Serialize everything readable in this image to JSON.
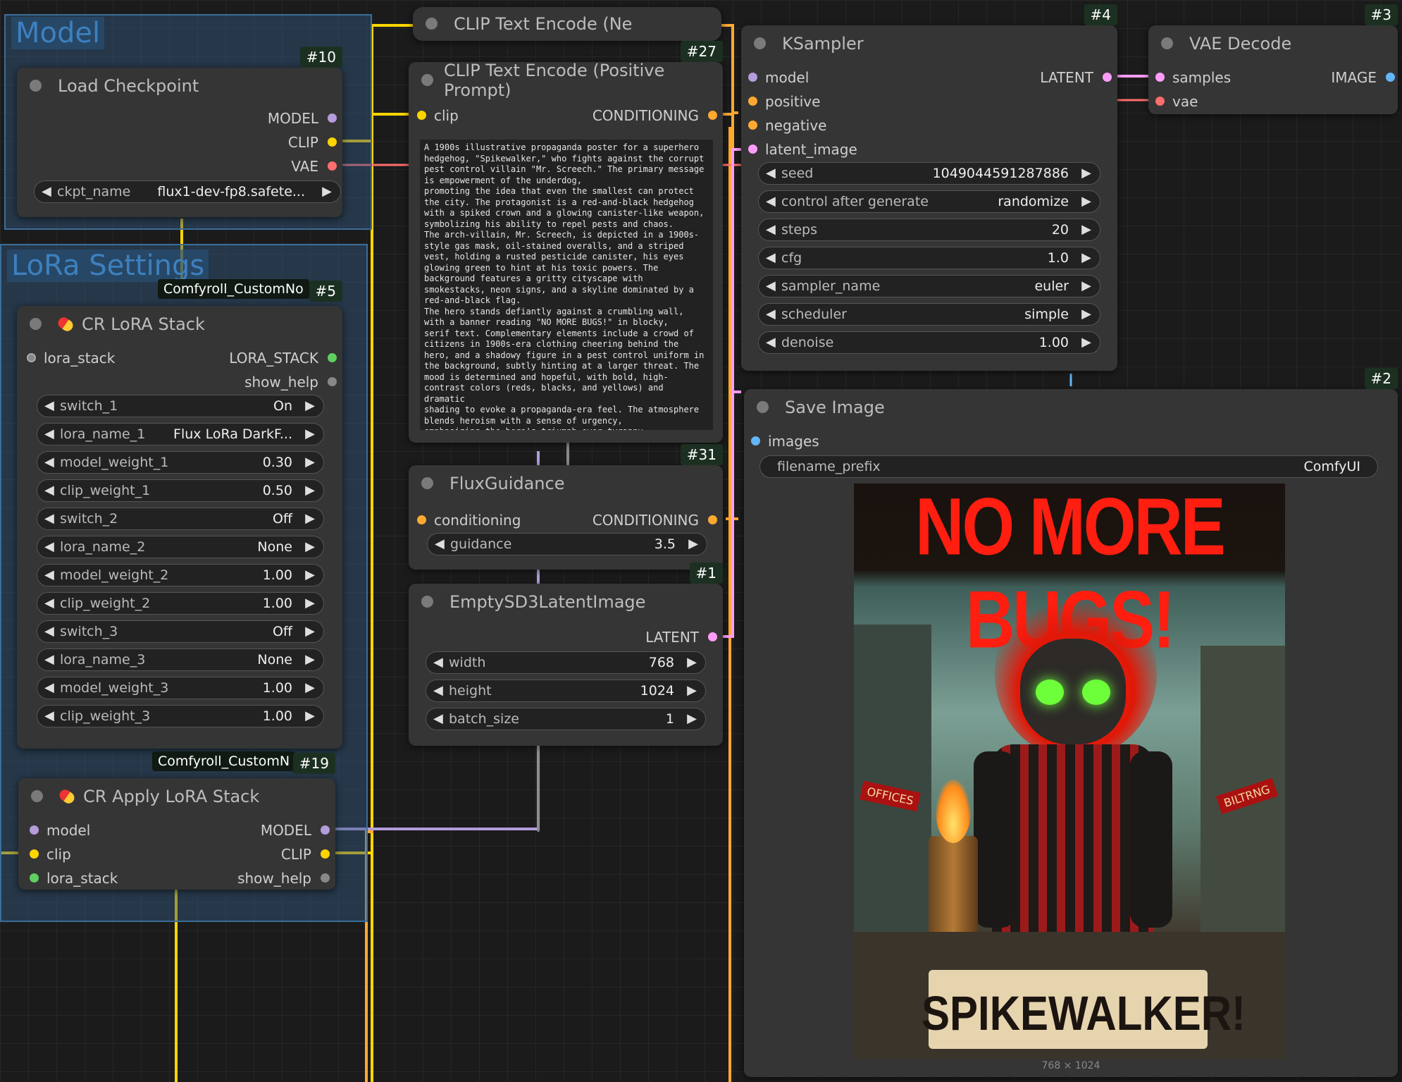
{
  "groups": {
    "model": "Model",
    "lora": "LoRa Settings"
  },
  "nodes": {
    "load_checkpoint": {
      "badge": "#10",
      "title": "Load Checkpoint",
      "out_model": "MODEL",
      "out_clip": "CLIP",
      "out_vae": "VAE",
      "ckpt_label": "ckpt_name",
      "ckpt_value": "flux1-dev-fp8.safete..."
    },
    "clip_neg": {
      "title": "CLIP Text Encode (Ne"
    },
    "clip_pos": {
      "badge": "#27",
      "title": "CLIP Text Encode (Positive Prompt)",
      "in_clip": "clip",
      "out": "CONDITIONING",
      "prompt": "A 1900s illustrative propaganda poster for a superhero hedgehog, \"Spikewalker,\" who fights against the corrupt pest control villain \"Mr. Screech.\" The primary message is empowerment of the underdog,\npromoting the idea that even the smallest can protect the city. The protagonist is a red-and-black hedgehog\nwith a spiked crown and a glowing canister-like weapon, symbolizing his ability to repel pests and chaos.\nThe arch-villain, Mr. Screech, is depicted in a 1900s-style gas mask, oil-stained overalls, and a striped vest, holding a rusted pesticide canister, his eyes glowing green to hint at his toxic powers. The background features a gritty cityscape with smokestacks, neon signs, and a skyline dominated by a red-and-black flag.\nThe hero stands defiantly against a crumbling wall, with a banner reading \"NO MORE BUGS!\" in blocky,\nserif text. Complementary elements include a crowd of citizens in 1900s-era clothing cheering behind the hero, and a shadowy figure in a pest control uniform in the background, subtly hinting at a larger threat. The mood is determined and hopeful, with bold, high-contrast colors (reds, blacks, and yellows) and dramatic\nshading to evoke a propaganda-era feel. The atmosphere blends heroism with a sense of urgency,\nemphasizing the hero's triumph over tyranny."
    },
    "ksampler": {
      "badge": "#4",
      "title": "KSampler",
      "in_model": "model",
      "in_positive": "positive",
      "in_negative": "negative",
      "in_latent": "latent_image",
      "out": "LATENT",
      "widgets": [
        {
          "label": "seed",
          "value": "1049044591287886"
        },
        {
          "label": "control after generate",
          "value": "randomize"
        },
        {
          "label": "steps",
          "value": "20"
        },
        {
          "label": "cfg",
          "value": "1.0"
        },
        {
          "label": "sampler_name",
          "value": "euler"
        },
        {
          "label": "scheduler",
          "value": "simple"
        },
        {
          "label": "denoise",
          "value": "1.00"
        }
      ]
    },
    "vae_decode": {
      "badge": "#3",
      "title": "VAE Decode",
      "in_samples": "samples",
      "in_vae": "vae",
      "out": "IMAGE"
    },
    "save_image": {
      "badge": "#2",
      "title": "Save Image",
      "in_images": "images",
      "prefix_label": "filename_prefix",
      "prefix_value": "ComfyUI",
      "poster_top": "NO MORE BUGS!",
      "poster_bottom": "SPIKEWALKER!",
      "poster_shop1": "OFFICES",
      "poster_shop2": "BILTRNG",
      "dims": "768 × 1024"
    },
    "cr_lora_stack": {
      "prop": "Comfyroll_CustomNo",
      "badge": "#5",
      "title": "CR LoRA Stack",
      "in_stack": "lora_stack",
      "out_stack": "LORA_STACK",
      "out_help": "show_help",
      "widgets": [
        {
          "label": "switch_1",
          "value": "On"
        },
        {
          "label": "lora_name_1",
          "value": "Flux LoRa DarkF..."
        },
        {
          "label": "model_weight_1",
          "value": "0.30"
        },
        {
          "label": "clip_weight_1",
          "value": "0.50"
        },
        {
          "label": "switch_2",
          "value": "Off"
        },
        {
          "label": "lora_name_2",
          "value": "None"
        },
        {
          "label": "model_weight_2",
          "value": "1.00"
        },
        {
          "label": "clip_weight_2",
          "value": "1.00"
        },
        {
          "label": "switch_3",
          "value": "Off"
        },
        {
          "label": "lora_name_3",
          "value": "None"
        },
        {
          "label": "model_weight_3",
          "value": "1.00"
        },
        {
          "label": "clip_weight_3",
          "value": "1.00"
        }
      ]
    },
    "flux_guidance": {
      "badge": "#31",
      "title": "FluxGuidance",
      "in_cond": "conditioning",
      "out": "CONDITIONING",
      "widget_label": "guidance",
      "widget_value": "3.5"
    },
    "empty_latent": {
      "badge": "#1",
      "title": "EmptySD3LatentImage",
      "out": "LATENT",
      "widgets": [
        {
          "label": "width",
          "value": "768"
        },
        {
          "label": "height",
          "value": "1024"
        },
        {
          "label": "batch_size",
          "value": "1"
        }
      ]
    },
    "cr_apply_lora": {
      "prop": "Comfyroll_CustomN",
      "badge": "#19",
      "title": "CR Apply LoRA Stack",
      "in_model": "model",
      "in_clip": "clip",
      "in_stack": "lora_stack",
      "out_model": "MODEL",
      "out_clip": "CLIP",
      "out_help": "show_help"
    }
  },
  "colors": {
    "model": "#b39ddb",
    "clip": "#ffd500",
    "vae": "#ff6e6e",
    "conditioning": "#ffa931",
    "latent": "#ff9cf9",
    "image": "#64b5f6",
    "lora": "#5fcf5f",
    "accent_blue": "#3d80be"
  }
}
